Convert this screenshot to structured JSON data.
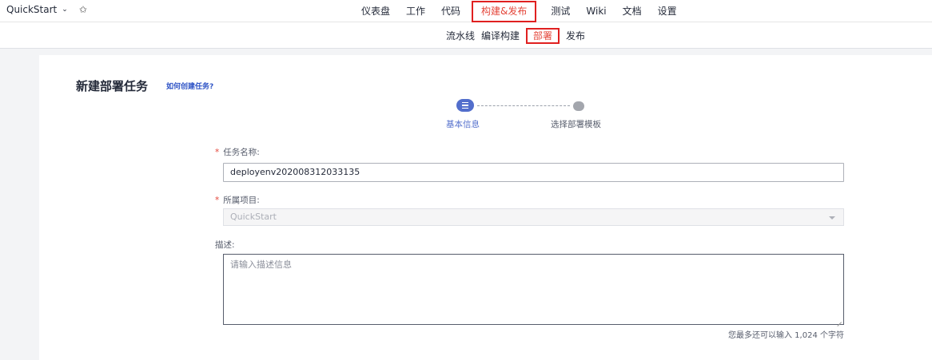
{
  "header": {
    "project_name": "QuickStart",
    "nav": [
      {
        "label": "仪表盘"
      },
      {
        "label": "工作"
      },
      {
        "label": "代码"
      },
      {
        "label": "构建&发布"
      },
      {
        "label": "测试"
      },
      {
        "label": "Wiki"
      },
      {
        "label": "文档"
      },
      {
        "label": "设置"
      }
    ],
    "active_nav": "构建&发布"
  },
  "subnav": {
    "items": [
      {
        "label": "流水线"
      },
      {
        "label": "编译构建"
      },
      {
        "label": "部署"
      },
      {
        "label": "发布"
      }
    ],
    "active": "部署"
  },
  "page": {
    "title": "新建部署任务",
    "help_link": "如何创建任务?"
  },
  "stepper": {
    "steps": [
      {
        "label": "基本信息"
      },
      {
        "label": "选择部署模板"
      }
    ],
    "current": "基本信息"
  },
  "form": {
    "task_name_label": "任务名称:",
    "task_name_value": "deployenv202008312033135",
    "project_label": "所属项目:",
    "project_value": "QuickStart",
    "description_label": "描述:",
    "description_placeholder": "请输入描述信息",
    "char_counter": "您最多还可以输入 1,024 个字符"
  },
  "colors": {
    "accent": "#526ecc",
    "active_nav": "#e4463a",
    "highlight_box": "#e02020",
    "link": "#2f54c6"
  },
  "icons": {
    "project_dropdown": "chevron-down-icon",
    "favorite": "star-outline-icon",
    "select_arrow": "caret-down-icon",
    "step_current": "list-icon"
  }
}
